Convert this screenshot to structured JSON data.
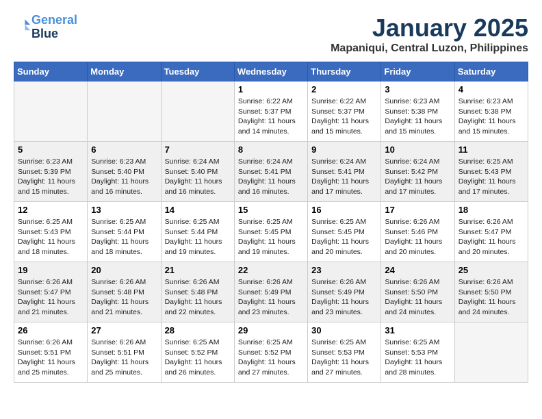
{
  "logo": {
    "line1": "General",
    "line2": "Blue"
  },
  "title": "January 2025",
  "location": "Mapaniqui, Central Luzon, Philippines",
  "days_of_week": [
    "Sunday",
    "Monday",
    "Tuesday",
    "Wednesday",
    "Thursday",
    "Friday",
    "Saturday"
  ],
  "weeks": [
    [
      {
        "day": "",
        "info": ""
      },
      {
        "day": "",
        "info": ""
      },
      {
        "day": "",
        "info": ""
      },
      {
        "day": "1",
        "info": "Sunrise: 6:22 AM\nSunset: 5:37 PM\nDaylight: 11 hours and 14 minutes."
      },
      {
        "day": "2",
        "info": "Sunrise: 6:22 AM\nSunset: 5:37 PM\nDaylight: 11 hours and 15 minutes."
      },
      {
        "day": "3",
        "info": "Sunrise: 6:23 AM\nSunset: 5:38 PM\nDaylight: 11 hours and 15 minutes."
      },
      {
        "day": "4",
        "info": "Sunrise: 6:23 AM\nSunset: 5:38 PM\nDaylight: 11 hours and 15 minutes."
      }
    ],
    [
      {
        "day": "5",
        "info": "Sunrise: 6:23 AM\nSunset: 5:39 PM\nDaylight: 11 hours and 15 minutes."
      },
      {
        "day": "6",
        "info": "Sunrise: 6:23 AM\nSunset: 5:40 PM\nDaylight: 11 hours and 16 minutes."
      },
      {
        "day": "7",
        "info": "Sunrise: 6:24 AM\nSunset: 5:40 PM\nDaylight: 11 hours and 16 minutes."
      },
      {
        "day": "8",
        "info": "Sunrise: 6:24 AM\nSunset: 5:41 PM\nDaylight: 11 hours and 16 minutes."
      },
      {
        "day": "9",
        "info": "Sunrise: 6:24 AM\nSunset: 5:41 PM\nDaylight: 11 hours and 17 minutes."
      },
      {
        "day": "10",
        "info": "Sunrise: 6:24 AM\nSunset: 5:42 PM\nDaylight: 11 hours and 17 minutes."
      },
      {
        "day": "11",
        "info": "Sunrise: 6:25 AM\nSunset: 5:43 PM\nDaylight: 11 hours and 17 minutes."
      }
    ],
    [
      {
        "day": "12",
        "info": "Sunrise: 6:25 AM\nSunset: 5:43 PM\nDaylight: 11 hours and 18 minutes."
      },
      {
        "day": "13",
        "info": "Sunrise: 6:25 AM\nSunset: 5:44 PM\nDaylight: 11 hours and 18 minutes."
      },
      {
        "day": "14",
        "info": "Sunrise: 6:25 AM\nSunset: 5:44 PM\nDaylight: 11 hours and 19 minutes."
      },
      {
        "day": "15",
        "info": "Sunrise: 6:25 AM\nSunset: 5:45 PM\nDaylight: 11 hours and 19 minutes."
      },
      {
        "day": "16",
        "info": "Sunrise: 6:25 AM\nSunset: 5:45 PM\nDaylight: 11 hours and 20 minutes."
      },
      {
        "day": "17",
        "info": "Sunrise: 6:26 AM\nSunset: 5:46 PM\nDaylight: 11 hours and 20 minutes."
      },
      {
        "day": "18",
        "info": "Sunrise: 6:26 AM\nSunset: 5:47 PM\nDaylight: 11 hours and 20 minutes."
      }
    ],
    [
      {
        "day": "19",
        "info": "Sunrise: 6:26 AM\nSunset: 5:47 PM\nDaylight: 11 hours and 21 minutes."
      },
      {
        "day": "20",
        "info": "Sunrise: 6:26 AM\nSunset: 5:48 PM\nDaylight: 11 hours and 21 minutes."
      },
      {
        "day": "21",
        "info": "Sunrise: 6:26 AM\nSunset: 5:48 PM\nDaylight: 11 hours and 22 minutes."
      },
      {
        "day": "22",
        "info": "Sunrise: 6:26 AM\nSunset: 5:49 PM\nDaylight: 11 hours and 23 minutes."
      },
      {
        "day": "23",
        "info": "Sunrise: 6:26 AM\nSunset: 5:49 PM\nDaylight: 11 hours and 23 minutes."
      },
      {
        "day": "24",
        "info": "Sunrise: 6:26 AM\nSunset: 5:50 PM\nDaylight: 11 hours and 24 minutes."
      },
      {
        "day": "25",
        "info": "Sunrise: 6:26 AM\nSunset: 5:50 PM\nDaylight: 11 hours and 24 minutes."
      }
    ],
    [
      {
        "day": "26",
        "info": "Sunrise: 6:26 AM\nSunset: 5:51 PM\nDaylight: 11 hours and 25 minutes."
      },
      {
        "day": "27",
        "info": "Sunrise: 6:26 AM\nSunset: 5:51 PM\nDaylight: 11 hours and 25 minutes."
      },
      {
        "day": "28",
        "info": "Sunrise: 6:25 AM\nSunset: 5:52 PM\nDaylight: 11 hours and 26 minutes."
      },
      {
        "day": "29",
        "info": "Sunrise: 6:25 AM\nSunset: 5:52 PM\nDaylight: 11 hours and 27 minutes."
      },
      {
        "day": "30",
        "info": "Sunrise: 6:25 AM\nSunset: 5:53 PM\nDaylight: 11 hours and 27 minutes."
      },
      {
        "day": "31",
        "info": "Sunrise: 6:25 AM\nSunset: 5:53 PM\nDaylight: 11 hours and 28 minutes."
      },
      {
        "day": "",
        "info": ""
      }
    ]
  ]
}
